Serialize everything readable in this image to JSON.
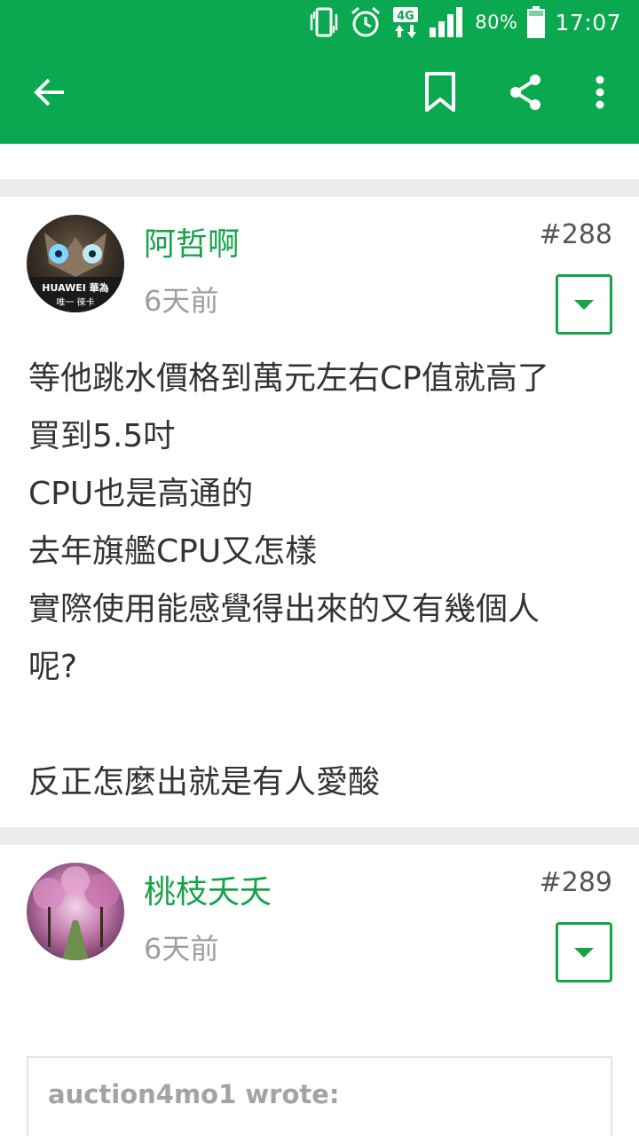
{
  "status_bar": {
    "battery": "80%",
    "time": "17:07",
    "network_label": "4G",
    "icons": [
      "vibrate-icon",
      "alarm-icon",
      "4g-icon",
      "signal-icon",
      "battery-icon"
    ]
  },
  "toolbar": {
    "icons": [
      "back-arrow-icon",
      "bookmark-icon",
      "share-icon",
      "more-vert-icon"
    ]
  },
  "colors": {
    "brand": "#0aa84f",
    "author": "#16a34a",
    "divider": "#ececec",
    "meta": "#9e9e9e"
  },
  "posts": [
    {
      "author": "阿哲啊",
      "time": "6天前",
      "number": "#288",
      "avatar_text_1": "HUAWEI 華為",
      "avatar_text_2": "唯一 徠卡",
      "lines": [
        "等他跳水價格到萬元左右CP值就高了",
        "買到5.5吋",
        "CPU也是高通的",
        "去年旗艦CPU又怎樣",
        "實際使用能感覺得出來的又有幾個人",
        "呢?",
        "",
        "反正怎麼出就是有人愛酸"
      ]
    },
    {
      "author": "桃枝夭夭",
      "time": "6天前",
      "number": "#289",
      "quote_label": "auction4mo1 wrote:"
    }
  ]
}
